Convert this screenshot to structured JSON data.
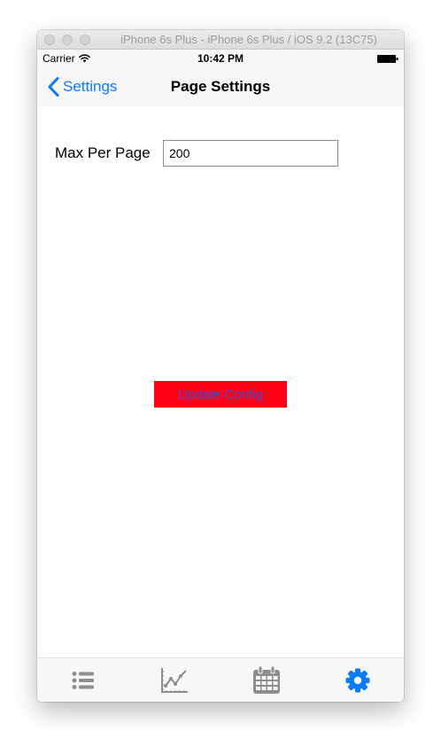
{
  "window": {
    "title": "iPhone 6s Plus - iPhone 6s Plus / iOS 9.2 (13C75)"
  },
  "status_bar": {
    "carrier": "Carrier",
    "time": "10:42 PM"
  },
  "nav_bar": {
    "back_label": "Settings",
    "title": "Page Settings"
  },
  "form": {
    "max_per_page_label": "Max Per Page",
    "max_per_page_value": "200"
  },
  "update_button": {
    "label": "Update Config"
  },
  "tab_bar": {
    "tabs": [
      {
        "icon": "list-icon",
        "selected": false
      },
      {
        "icon": "chart-icon",
        "selected": false
      },
      {
        "icon": "calendar-icon",
        "selected": false
      },
      {
        "icon": "gear-icon",
        "selected": true
      }
    ]
  },
  "colors": {
    "accent": "#0a7aff",
    "tab_inactive": "#8e8e8e",
    "button_background": "#ff0016",
    "button_text": "#3a4fd6"
  }
}
